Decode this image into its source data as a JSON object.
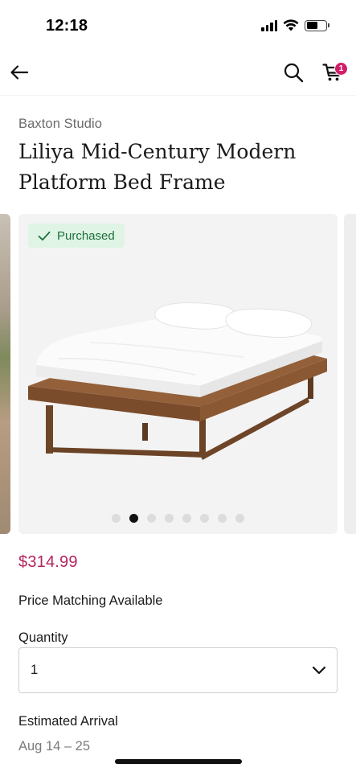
{
  "status_bar": {
    "time": "12:18"
  },
  "nav": {
    "cart_count": "1"
  },
  "product": {
    "brand": "Baxton Studio",
    "title": "Liliya Mid-Century Modern Platform Bed Frame",
    "badge": "Purchased",
    "price": "$314.99",
    "price_matching": "Price Matching Available"
  },
  "carousel": {
    "total_images": 8,
    "active_index": 1
  },
  "quantity": {
    "label": "Quantity",
    "selected": "1"
  },
  "arrival": {
    "label": "Estimated Arrival",
    "date": "Aug 14 – 25"
  },
  "colors": {
    "accent": "#b3245f",
    "badge_bg": "#dff4e4",
    "badge_text": "#1b6f3c",
    "cart_badge": "#d01f68"
  },
  "icons": [
    "signal-icon",
    "wifi-icon",
    "battery-icon",
    "back-arrow-icon",
    "search-icon",
    "cart-icon",
    "check-icon",
    "chevron-down-icon"
  ]
}
